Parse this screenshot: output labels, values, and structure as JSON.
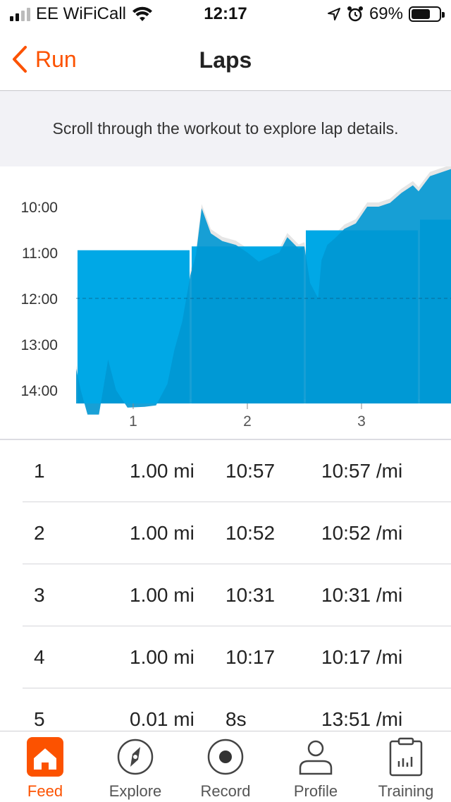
{
  "status_bar": {
    "carrier": "EE WiFiCall",
    "time": "12:17",
    "battery": "69%",
    "battery_level": 0.69,
    "icons": [
      "signal-icon",
      "wifi-icon",
      "location-icon",
      "alarm-icon",
      "battery-icon"
    ]
  },
  "nav": {
    "back_label": "Run",
    "title": "Laps",
    "back_icon": "chevron-left-icon"
  },
  "banner": {
    "text": "Scroll through the workout to explore lap details."
  },
  "chart_data": {
    "type": "bar",
    "categories": [
      "1",
      "2",
      "3",
      "4"
    ],
    "values": [
      "10:57",
      "10:52",
      "10:31",
      "10:17"
    ],
    "values_seconds_per_mi": [
      657,
      652,
      631,
      617
    ],
    "y_tick_labels": [
      "10:00",
      "11:00",
      "12:00",
      "13:00",
      "14:00"
    ],
    "y_axis_inverted": true,
    "ylim": [
      "10:00",
      "14:00"
    ],
    "average_line": "12:00",
    "colors": {
      "bar": "#00a8e6",
      "pace_area": "#0097d3",
      "pace_area_above": "#e6e6e6"
    },
    "pace_trace": {
      "description_values_in_seconds_per_mi": true,
      "points": [
        [
          0.0,
          812
        ],
        [
          0.04,
          840
        ],
        [
          0.1,
          872
        ],
        [
          0.2,
          872
        ],
        [
          0.28,
          800
        ],
        [
          0.35,
          840
        ],
        [
          0.45,
          863
        ],
        [
          0.6,
          862
        ],
        [
          0.7,
          860
        ],
        [
          0.8,
          832
        ],
        [
          0.86,
          788
        ],
        [
          0.93,
          750
        ],
        [
          1.0,
          690
        ],
        [
          1.05,
          663
        ],
        [
          1.1,
          602
        ],
        [
          1.18,
          635
        ],
        [
          1.28,
          645
        ],
        [
          1.4,
          650
        ],
        [
          1.5,
          660
        ],
        [
          1.6,
          672
        ],
        [
          1.7,
          665
        ],
        [
          1.78,
          660
        ],
        [
          1.85,
          640
        ],
        [
          1.95,
          655
        ],
        [
          2.0,
          652
        ],
        [
          2.05,
          700
        ],
        [
          2.12,
          720
        ],
        [
          2.15,
          670
        ],
        [
          2.2,
          650
        ],
        [
          2.27,
          641
        ],
        [
          2.35,
          629
        ],
        [
          2.45,
          622
        ],
        [
          2.55,
          600
        ],
        [
          2.65,
          600
        ],
        [
          2.75,
          595
        ],
        [
          2.85,
          582
        ],
        [
          2.95,
          572
        ],
        [
          3.0,
          580
        ],
        [
          3.1,
          560
        ],
        [
          3.2,
          555
        ],
        [
          3.3,
          550
        ],
        [
          3.4,
          560
        ],
        [
          3.55,
          590
        ],
        [
          3.65,
          620
        ],
        [
          3.72,
          640
        ]
      ]
    }
  },
  "laps": [
    {
      "num": "1",
      "distance": "1.00 mi",
      "time": "10:57",
      "pace": "10:57 /mi"
    },
    {
      "num": "2",
      "distance": "1.00 mi",
      "time": "10:52",
      "pace": "10:52 /mi"
    },
    {
      "num": "3",
      "distance": "1.00 mi",
      "time": "10:31",
      "pace": "10:31 /mi"
    },
    {
      "num": "4",
      "distance": "1.00 mi",
      "time": "10:17",
      "pace": "10:17 /mi"
    },
    {
      "num": "5",
      "distance": "0.01 mi",
      "time": "8s",
      "pace": "13:51 /mi"
    }
  ],
  "tabbar": {
    "active_color": "#fc5200",
    "tabs": [
      {
        "label": "Feed",
        "icon": "home-icon",
        "active": true
      },
      {
        "label": "Explore",
        "icon": "compass-icon",
        "active": false
      },
      {
        "label": "Record",
        "icon": "record-icon",
        "active": false
      },
      {
        "label": "Profile",
        "icon": "profile-icon",
        "active": false
      },
      {
        "label": "Training",
        "icon": "training-icon",
        "active": false
      }
    ]
  }
}
